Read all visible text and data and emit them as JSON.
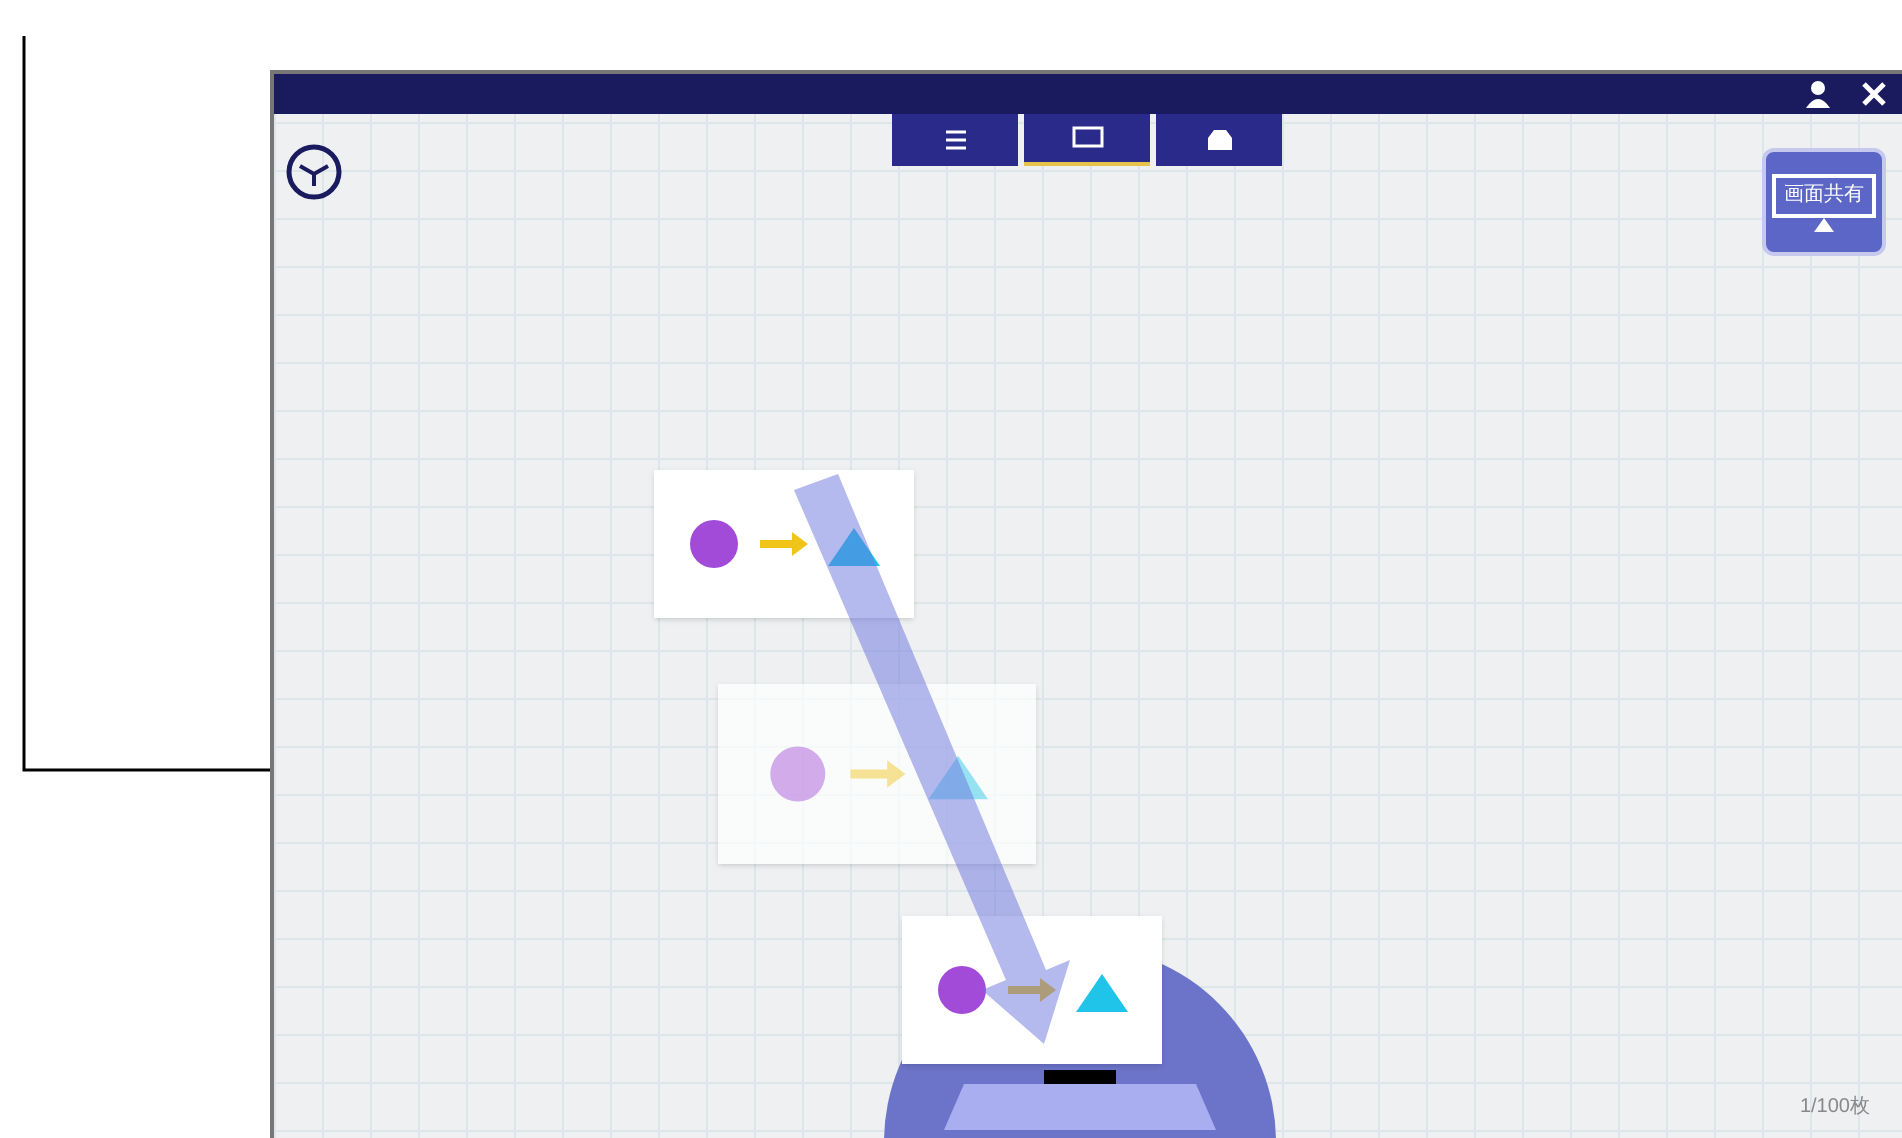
{
  "tabs": [
    {
      "kind": "list",
      "selected": false
    },
    {
      "kind": "screen",
      "selected": true
    },
    {
      "kind": "inbox",
      "selected": false
    }
  ],
  "share_button": {
    "label": "画面共有"
  },
  "cards": [
    {
      "kind": "normal"
    },
    {
      "kind": "ghost"
    },
    {
      "kind": "normal"
    }
  ],
  "page_counter": "1/100枚"
}
